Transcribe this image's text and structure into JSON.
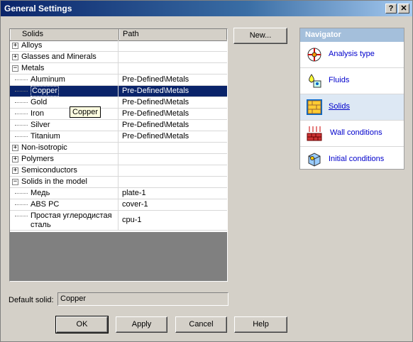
{
  "window": {
    "title": "General Settings",
    "help_glyph": "?",
    "close_glyph": "✕"
  },
  "grid": {
    "columns": [
      "Solids",
      "Path"
    ],
    "rows": [
      {
        "label": "Alloys",
        "path": "",
        "level": 0,
        "expander": "+"
      },
      {
        "label": "Glasses and Minerals",
        "path": "",
        "level": 0,
        "expander": "+"
      },
      {
        "label": "Metals",
        "path": "",
        "level": 0,
        "expander": "−"
      },
      {
        "label": "Aluminum",
        "path": "Pre-Defined\\Metals",
        "level": 1
      },
      {
        "label": "Copper",
        "path": "Pre-Defined\\Metals",
        "level": 1,
        "selected": true
      },
      {
        "label": "Gold",
        "path": "Pre-Defined\\Metals",
        "level": 1
      },
      {
        "label": "Iron",
        "path": "Pre-Defined\\Metals",
        "level": 1
      },
      {
        "label": "Silver",
        "path": "Pre-Defined\\Metals",
        "level": 1
      },
      {
        "label": "Titanium",
        "path": "Pre-Defined\\Metals",
        "level": 1
      },
      {
        "label": "Non-isotropic",
        "path": "",
        "level": 0,
        "expander": "+"
      },
      {
        "label": "Polymers",
        "path": "",
        "level": 0,
        "expander": "+"
      },
      {
        "label": "Semiconductors",
        "path": "",
        "level": 0,
        "expander": "+"
      },
      {
        "label": "Solids in the model",
        "path": "",
        "level": 0,
        "expander": "−"
      },
      {
        "label": "Медь",
        "path": "plate-1",
        "level": 1
      },
      {
        "label": "ABS PC",
        "path": "cover-1",
        "level": 1
      },
      {
        "label": "Простая углеродистая сталь",
        "path": "cpu-1",
        "level": 1,
        "tall": true
      }
    ],
    "tooltip": "Copper"
  },
  "buttons": {
    "new": "New...",
    "ok": "OK",
    "apply": "Apply",
    "cancel": "Cancel",
    "help": "Help"
  },
  "default_solid": {
    "label": "Default solid:",
    "value": "Copper"
  },
  "navigator": {
    "title": "Navigator",
    "items": [
      {
        "label": "Analysis type",
        "icon": "analysis-type-icon"
      },
      {
        "label": "Fluids",
        "icon": "fluids-icon"
      },
      {
        "label": "Solids",
        "icon": "solids-icon",
        "active": true
      },
      {
        "label": "Wall conditions",
        "icon": "wall-conditions-icon"
      },
      {
        "label": "Initial conditions",
        "icon": "initial-conditions-icon"
      }
    ]
  },
  "colors": {
    "selection": "#0a246a",
    "link": "#0000cc",
    "nav_header": "#a4bfdb"
  }
}
